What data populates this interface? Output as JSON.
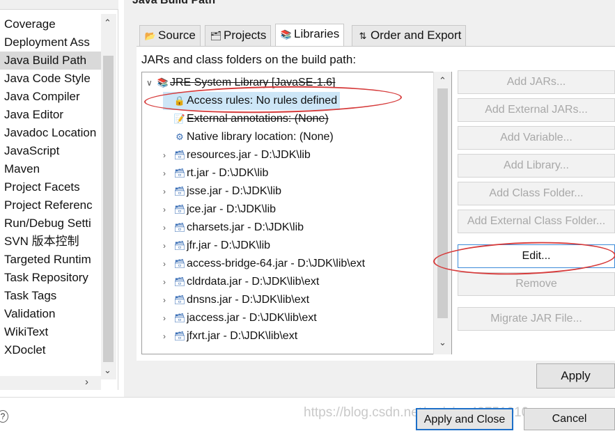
{
  "window": {
    "heading": "Java Build Path"
  },
  "categories": [
    "Coverage",
    "Deployment Ass",
    "Java Build Path",
    "Java Code Style",
    "Java Compiler",
    "Java Editor",
    "Javadoc Location",
    "JavaScript",
    "Maven",
    "Project Facets",
    "Project Referenc",
    "Run/Debug Setti",
    "SVN 版本控制",
    "Targeted Runtim",
    "Task Repository",
    "Task Tags",
    "Validation",
    "WikiText",
    "XDoclet"
  ],
  "selected_category": "Java Build Path",
  "tabs": [
    {
      "label": "Source",
      "icon": "source-folder-icon"
    },
    {
      "label": "Projects",
      "icon": "projects-icon"
    },
    {
      "label": "Libraries",
      "icon": "libraries-icon",
      "active": true
    },
    {
      "label": "Order and Export",
      "icon": "order-export-icon"
    }
  ],
  "jars_label": "JARs and class folders on the build path:",
  "tree": {
    "root": "JRE System Library [JavaSE-1.6]",
    "children": [
      {
        "label": "Access rules: No rules defined",
        "icon": "access-rules-icon",
        "selected": true
      },
      {
        "label": "External annotations: (None)",
        "icon": "annotations-icon"
      },
      {
        "label": "Native library location: (None)",
        "icon": "native-library-icon"
      }
    ],
    "jars": [
      "resources.jar - D:\\JDK\\lib",
      "rt.jar - D:\\JDK\\lib",
      "jsse.jar - D:\\JDK\\lib",
      "jce.jar - D:\\JDK\\lib",
      "charsets.jar - D:\\JDK\\lib",
      "jfr.jar - D:\\JDK\\lib",
      "access-bridge-64.jar - D:\\JDK\\lib\\ext",
      "cldrdata.jar - D:\\JDK\\lib\\ext",
      "dnsns.jar - D:\\JDK\\lib\\ext",
      "jaccess.jar - D:\\JDK\\lib\\ext",
      "jfxrt.jar - D:\\JDK\\lib\\ext"
    ]
  },
  "buttons": {
    "add_jars": "Add JARs...",
    "add_external_jars": "Add External JARs...",
    "add_variable": "Add Variable...",
    "add_library": "Add Library...",
    "add_class_folder": "Add Class Folder...",
    "add_external_class_folder": "Add External Class Folder...",
    "edit": "Edit...",
    "remove": "Remove",
    "migrate": "Migrate JAR File...",
    "apply": "Apply",
    "apply_and_close": "Apply and Close",
    "cancel": "Cancel"
  },
  "watermark": "https://blog.csdn.net/weixin_43751010",
  "colors": {
    "annotation": "#d63b3b",
    "selection": "#cde6f7",
    "focus": "#1d6fc8"
  }
}
